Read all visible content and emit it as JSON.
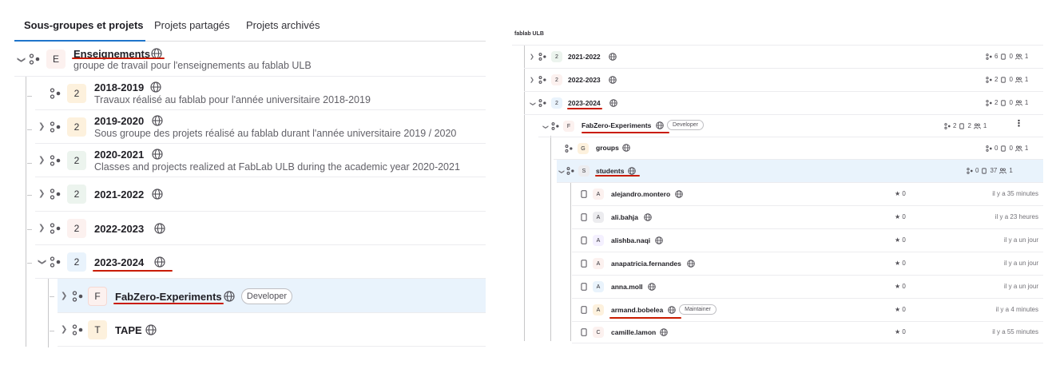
{
  "left": {
    "tabs": [
      "Sous-groupes et projets",
      "Projets partagés",
      "Projets archivés"
    ],
    "rows": [
      {
        "avatar": "E",
        "name": "Enseignements",
        "desc": "groupe de travail pour l'enseignements au fablab ULB"
      },
      {
        "avatar": "2",
        "name": "2018-2019",
        "desc": "Travaux réalisé au fablab pour l'année universitaire 2018-2019"
      },
      {
        "avatar": "2",
        "name": "2019-2020",
        "desc": "Sous groupe des projets réalisé au fablab durant l'année universitaire 2019 / 2020"
      },
      {
        "avatar": "2",
        "name": "2020-2021",
        "desc": "Classes and projects realized at FabLab ULB during the academic year 2020-2021"
      },
      {
        "avatar": "2",
        "name": "2021-2022",
        "desc": ""
      },
      {
        "avatar": "2",
        "name": "2022-2023",
        "desc": ""
      },
      {
        "avatar": "2",
        "name": "2023-2024",
        "desc": ""
      },
      {
        "avatar": "F",
        "name": "FabZero-Experiments",
        "desc": "",
        "badge": "Developer"
      },
      {
        "avatar": "T",
        "name": "TAPE",
        "desc": ""
      }
    ]
  },
  "right": {
    "breadcrumb": "fablab ULB",
    "groups": [
      {
        "avatar": "2",
        "name": "2021-2022",
        "subgroups": "6",
        "projects": "0",
        "members": "1"
      },
      {
        "avatar": "2",
        "name": "2022-2023",
        "subgroups": "2",
        "projects": "0",
        "members": "1"
      },
      {
        "avatar": "2",
        "name": "2023-2024",
        "subgroups": "2",
        "projects": "0",
        "members": "1"
      },
      {
        "avatar": "F",
        "name": "FabZero-Experiments",
        "badge": "Developer",
        "subgroups": "2",
        "projects": "2",
        "members": "1"
      },
      {
        "avatar": "G",
        "name": "groups",
        "subgroups": "0",
        "projects": "0",
        "members": "1"
      },
      {
        "avatar": "S",
        "name": "students",
        "subgroups": "0",
        "projects": "37",
        "members": "1"
      }
    ],
    "projects": [
      {
        "avatar": "A",
        "name": "alejandro.montero",
        "stars": "0",
        "time": "il y a 35 minutes"
      },
      {
        "avatar": "A",
        "name": "ali.bahja",
        "stars": "0",
        "time": "il y a 23 heures"
      },
      {
        "avatar": "A",
        "name": "alishba.naqi",
        "stars": "0",
        "time": "il y a un jour"
      },
      {
        "avatar": "A",
        "name": "anapatricia.fernandes",
        "stars": "0",
        "time": "il y a un jour"
      },
      {
        "avatar": "A",
        "name": "anna.moll",
        "stars": "0",
        "time": "il y a un jour"
      },
      {
        "avatar": "A",
        "name": "armand.bobelea",
        "badge": "Maintainer",
        "stars": "0",
        "time": "il y a 4 minutes"
      },
      {
        "avatar": "C",
        "name": "camille.lamon",
        "stars": "0",
        "time": "il y a 55 minutes"
      }
    ]
  },
  "colors": {
    "accent": "#1f75cb",
    "annotation": "#c91c00",
    "selected_row": "#e9f3fc"
  },
  "icons": [
    "chevron-right-icon",
    "chevron-down-icon",
    "subgroup-icon",
    "globe-icon",
    "project-icon",
    "star-icon",
    "member-icon",
    "kebab-icon"
  ]
}
